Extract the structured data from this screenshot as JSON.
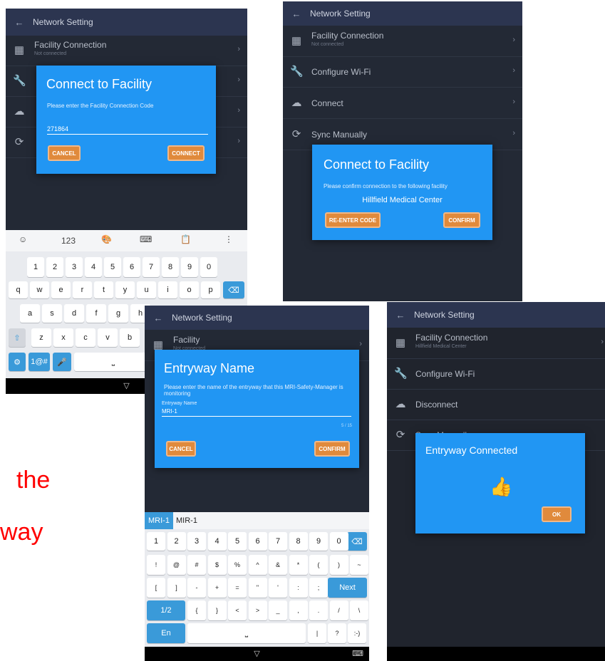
{
  "caption": {
    "line1": "the",
    "line2": "way",
    "color": "#ff0000"
  },
  "appbar_title": "Network Setting",
  "colors": {
    "dialog": "#2196f3",
    "button": "#e08a3c",
    "appbar": "#2c3550",
    "bg": "#232935"
  },
  "s1": {
    "row1_title": "Facility Connection",
    "row1_sub": "Not connected",
    "dialog_title": "Connect to Facility",
    "dialog_text": "Please enter the Facility Connection Code",
    "code_value": "271864",
    "cancel": "CANCEL",
    "connect": "CONNECT",
    "toolbar_123": "123",
    "num_keys": [
      "1",
      "2",
      "3",
      "4",
      "5",
      "6",
      "7",
      "8",
      "9",
      "0"
    ],
    "num_subs": [
      "!",
      "@",
      "#",
      "$",
      "%",
      "^",
      "&",
      "*",
      "(",
      ")"
    ],
    "row_q": [
      "q",
      "w",
      "e",
      "r",
      "t",
      "y",
      "u",
      "i",
      "o",
      "p"
    ],
    "row_a": [
      "a",
      "s",
      "d",
      "f",
      "g",
      "h"
    ],
    "row_z": [
      "z",
      "x",
      "c",
      "v",
      "b"
    ],
    "sym_key": "1@#"
  },
  "s2": {
    "row1_title": "Facility Connection",
    "row1_sub": "Not connected",
    "row2_title": "Configure Wi-Fi",
    "row3_title": "Connect",
    "row4_title": "Sync Manually",
    "dialog_title": "Connect to Facility",
    "dialog_text": "Please confirm connection to the following facility",
    "facility": "Hillfield Medical Center",
    "reenter": "RE-ENTER CODE",
    "confirm": "CONFIRM"
  },
  "s3": {
    "row1_title": "Facility",
    "row1_sub": "Not connected",
    "dialog_title": "Entryway Name",
    "dialog_text": "Please enter the name of the entryway that this MRI-Safety-Manager is monitoring",
    "field_label": "Entryway Name",
    "field_value": "MRI-1",
    "counter": "5 / 15",
    "cancel": "CANCEL",
    "confirm": "CONFIRM",
    "suggest1": "MRI-1",
    "suggest2": "MIR-1",
    "krow1": [
      "1",
      "2",
      "3",
      "4",
      "5",
      "6",
      "7",
      "8",
      "9",
      "0"
    ],
    "krow2": [
      "!",
      "@",
      "#",
      "$",
      "%",
      "^",
      "&",
      "*",
      "(",
      ")",
      "~"
    ],
    "krow3": [
      "[",
      "]",
      "-",
      "+",
      "=",
      "\"",
      "'",
      ":",
      ";"
    ],
    "next": "Next",
    "krow4_first": "1/2",
    "krow4": [
      "{",
      "}",
      "<",
      ">",
      "_",
      ",",
      ".",
      "/",
      "\\"
    ],
    "en": "En",
    "krow5_right": [
      "|",
      "?",
      ":-)"
    ]
  },
  "s4": {
    "row1_title": "Facility Connection",
    "row1_sub": "Hillfield Medical Center",
    "row2_title": "Configure Wi-Fi",
    "row3_title": "Disconnect",
    "row4_title": "Sync Manually",
    "dialog_title": "Entryway Connected",
    "ok": "OK"
  }
}
